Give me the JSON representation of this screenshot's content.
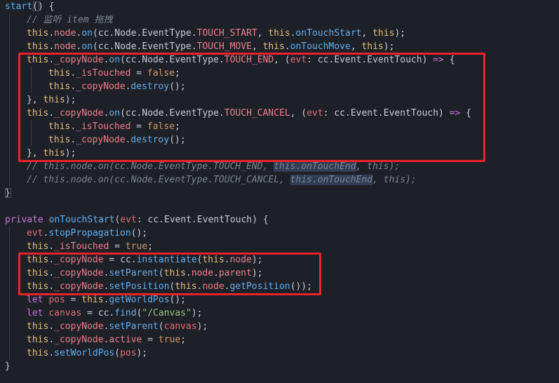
{
  "lines": [
    {
      "indent": 0,
      "tokens": [
        {
          "c": "t-method",
          "v": "start"
        },
        {
          "c": "t-punc",
          "v": "() "
        },
        {
          "c": "t-punc",
          "v": "{"
        }
      ]
    },
    {
      "indent": 1,
      "tokens": [
        {
          "c": "t-comment",
          "v": "// 监听 item 拖拽"
        }
      ]
    },
    {
      "indent": 1,
      "tokens": [
        {
          "c": "t-this",
          "v": "this"
        },
        {
          "c": "t-punc",
          "v": "."
        },
        {
          "c": "t-prop",
          "v": "node"
        },
        {
          "c": "t-punc",
          "v": "."
        },
        {
          "c": "t-method",
          "v": "on"
        },
        {
          "c": "t-punc",
          "v": "(cc.Node.EventType."
        },
        {
          "c": "t-const",
          "v": "TOUCH_START"
        },
        {
          "c": "t-punc",
          "v": ", "
        },
        {
          "c": "t-this",
          "v": "this"
        },
        {
          "c": "t-punc",
          "v": "."
        },
        {
          "c": "t-method",
          "v": "onTouchStart"
        },
        {
          "c": "t-punc",
          "v": ", "
        },
        {
          "c": "t-this",
          "v": "this"
        },
        {
          "c": "t-punc",
          "v": ");"
        }
      ]
    },
    {
      "indent": 1,
      "tokens": [
        {
          "c": "t-this",
          "v": "this"
        },
        {
          "c": "t-punc",
          "v": "."
        },
        {
          "c": "t-prop",
          "v": "node"
        },
        {
          "c": "t-punc",
          "v": "."
        },
        {
          "c": "t-method",
          "v": "on"
        },
        {
          "c": "t-punc",
          "v": "(cc.Node.EventType."
        },
        {
          "c": "t-const",
          "v": "TOUCH_MOVE"
        },
        {
          "c": "t-punc",
          "v": ", "
        },
        {
          "c": "t-this",
          "v": "this"
        },
        {
          "c": "t-punc",
          "v": "."
        },
        {
          "c": "t-method",
          "v": "onTouchMove"
        },
        {
          "c": "t-punc",
          "v": ", "
        },
        {
          "c": "t-this",
          "v": "this"
        },
        {
          "c": "t-punc",
          "v": ");"
        }
      ]
    },
    {
      "indent": 1,
      "tokens": [
        {
          "c": "t-this",
          "v": "this"
        },
        {
          "c": "t-punc",
          "v": "."
        },
        {
          "c": "t-prop",
          "v": "_copyNode"
        },
        {
          "c": "t-punc",
          "v": "."
        },
        {
          "c": "t-method",
          "v": "on"
        },
        {
          "c": "t-punc",
          "v": "(cc.Node.EventType."
        },
        {
          "c": "t-const",
          "v": "TOUCH_END"
        },
        {
          "c": "t-punc",
          "v": ", ("
        },
        {
          "c": "t-param",
          "v": "evt"
        },
        {
          "c": "t-punc",
          "v": ": cc.Event.EventTouch) "
        },
        {
          "c": "t-kw",
          "v": "=>"
        },
        {
          "c": "t-punc",
          "v": " {"
        }
      ]
    },
    {
      "indent": 2,
      "tokens": [
        {
          "c": "t-this",
          "v": "this"
        },
        {
          "c": "t-punc",
          "v": "."
        },
        {
          "c": "t-prop",
          "v": "_isTouched"
        },
        {
          "c": "t-punc",
          "v": " = "
        },
        {
          "c": "t-bool",
          "v": "false"
        },
        {
          "c": "t-punc",
          "v": ";"
        }
      ]
    },
    {
      "indent": 2,
      "tokens": [
        {
          "c": "t-this",
          "v": "this"
        },
        {
          "c": "t-punc",
          "v": "."
        },
        {
          "c": "t-prop",
          "v": "_copyNode"
        },
        {
          "c": "t-punc",
          "v": "."
        },
        {
          "c": "t-method",
          "v": "destroy"
        },
        {
          "c": "t-punc",
          "v": "();"
        }
      ]
    },
    {
      "indent": 1,
      "tokens": [
        {
          "c": "t-punc",
          "v": "}, "
        },
        {
          "c": "t-this",
          "v": "this"
        },
        {
          "c": "t-punc",
          "v": ");"
        }
      ]
    },
    {
      "indent": 1,
      "tokens": [
        {
          "c": "t-this",
          "v": "this"
        },
        {
          "c": "t-punc",
          "v": "."
        },
        {
          "c": "t-prop",
          "v": "_copyNode"
        },
        {
          "c": "t-punc",
          "v": "."
        },
        {
          "c": "t-method",
          "v": "on"
        },
        {
          "c": "t-punc",
          "v": "(cc.Node.EventType."
        },
        {
          "c": "t-const",
          "v": "TOUCH_CANCEL"
        },
        {
          "c": "t-punc",
          "v": ", ("
        },
        {
          "c": "t-param",
          "v": "evt"
        },
        {
          "c": "t-punc",
          "v": ": cc.Event.EventTouch) "
        },
        {
          "c": "t-kw",
          "v": "=>"
        },
        {
          "c": "t-punc",
          "v": " {"
        }
      ]
    },
    {
      "indent": 2,
      "tokens": [
        {
          "c": "t-this",
          "v": "this"
        },
        {
          "c": "t-punc",
          "v": "."
        },
        {
          "c": "t-prop",
          "v": "_isTouched"
        },
        {
          "c": "t-punc",
          "v": " = "
        },
        {
          "c": "t-bool",
          "v": "false"
        },
        {
          "c": "t-punc",
          "v": ";"
        }
      ]
    },
    {
      "indent": 2,
      "tokens": [
        {
          "c": "t-this",
          "v": "this"
        },
        {
          "c": "t-punc",
          "v": "."
        },
        {
          "c": "t-prop",
          "v": "_copyNode"
        },
        {
          "c": "t-punc",
          "v": "."
        },
        {
          "c": "t-method",
          "v": "destroy"
        },
        {
          "c": "t-punc",
          "v": "();"
        }
      ]
    },
    {
      "indent": 1,
      "tokens": [
        {
          "c": "t-punc",
          "v": "}, "
        },
        {
          "c": "t-this",
          "v": "this"
        },
        {
          "c": "t-punc",
          "v": ");"
        }
      ]
    },
    {
      "indent": 1,
      "tokens": [
        {
          "c": "t-comment",
          "v": "// this.node.on(cc.Node.EventType.TOUCH_END, "
        },
        {
          "c": "t-comment t-hl",
          "v": "this.onTouchEnd"
        },
        {
          "c": "t-comment",
          "v": ", this);"
        }
      ]
    },
    {
      "indent": 1,
      "tokens": [
        {
          "c": "t-comment",
          "v": "// this.node.on(cc.Node.EventType.TOUCH_CANCEL, "
        },
        {
          "c": "t-comment t-hl",
          "v": "this.onTouchEnd"
        },
        {
          "c": "t-comment",
          "v": ", this);"
        }
      ]
    },
    {
      "indent": 0,
      "tokens": [
        {
          "c": "t-punc",
          "v": "}"
        }
      ]
    },
    {
      "indent": 0,
      "tokens": []
    },
    {
      "indent": 0,
      "tokens": [
        {
          "c": "t-kw",
          "v": "private"
        },
        {
          "c": "t-punc",
          "v": " "
        },
        {
          "c": "t-method",
          "v": "onTouchStart"
        },
        {
          "c": "t-punc",
          "v": "("
        },
        {
          "c": "t-param",
          "v": "evt"
        },
        {
          "c": "t-punc",
          "v": ": cc.Event.EventTouch) {"
        }
      ]
    },
    {
      "indent": 1,
      "tokens": [
        {
          "c": "t-param",
          "v": "evt"
        },
        {
          "c": "t-punc",
          "v": "."
        },
        {
          "c": "t-method",
          "v": "stopPropagation"
        },
        {
          "c": "t-punc",
          "v": "();"
        }
      ]
    },
    {
      "indent": 1,
      "tokens": [
        {
          "c": "t-this",
          "v": "this"
        },
        {
          "c": "t-punc",
          "v": "."
        },
        {
          "c": "t-prop",
          "v": "_isTouched"
        },
        {
          "c": "t-punc",
          "v": " = "
        },
        {
          "c": "t-bool",
          "v": "true"
        },
        {
          "c": "t-punc",
          "v": ";"
        }
      ]
    },
    {
      "indent": 1,
      "tokens": [
        {
          "c": "t-this",
          "v": "this"
        },
        {
          "c": "t-punc",
          "v": "."
        },
        {
          "c": "t-prop",
          "v": "_copyNode"
        },
        {
          "c": "t-punc",
          "v": " = cc."
        },
        {
          "c": "t-method",
          "v": "instantiate"
        },
        {
          "c": "t-punc",
          "v": "("
        },
        {
          "c": "t-this",
          "v": "this"
        },
        {
          "c": "t-punc",
          "v": "."
        },
        {
          "c": "t-prop",
          "v": "node"
        },
        {
          "c": "t-punc",
          "v": ");"
        }
      ]
    },
    {
      "indent": 1,
      "tokens": [
        {
          "c": "t-this",
          "v": "this"
        },
        {
          "c": "t-punc",
          "v": "."
        },
        {
          "c": "t-prop",
          "v": "_copyNode"
        },
        {
          "c": "t-punc",
          "v": "."
        },
        {
          "c": "t-method",
          "v": "setParent"
        },
        {
          "c": "t-punc",
          "v": "("
        },
        {
          "c": "t-this",
          "v": "this"
        },
        {
          "c": "t-punc",
          "v": "."
        },
        {
          "c": "t-prop",
          "v": "node"
        },
        {
          "c": "t-punc",
          "v": "."
        },
        {
          "c": "t-prop",
          "v": "parent"
        },
        {
          "c": "t-punc",
          "v": ");"
        }
      ]
    },
    {
      "indent": 1,
      "tokens": [
        {
          "c": "t-this",
          "v": "this"
        },
        {
          "c": "t-punc",
          "v": "."
        },
        {
          "c": "t-prop",
          "v": "_copyNode"
        },
        {
          "c": "t-punc",
          "v": "."
        },
        {
          "c": "t-method",
          "v": "setPosition"
        },
        {
          "c": "t-punc",
          "v": "("
        },
        {
          "c": "t-this",
          "v": "this"
        },
        {
          "c": "t-punc",
          "v": "."
        },
        {
          "c": "t-prop",
          "v": "node"
        },
        {
          "c": "t-punc",
          "v": "."
        },
        {
          "c": "t-method",
          "v": "getPosition"
        },
        {
          "c": "t-punc",
          "v": "());"
        }
      ]
    },
    {
      "indent": 1,
      "tokens": [
        {
          "c": "t-kw",
          "v": "let"
        },
        {
          "c": "t-punc",
          "v": " "
        },
        {
          "c": "t-param",
          "v": "pos"
        },
        {
          "c": "t-punc",
          "v": " = "
        },
        {
          "c": "t-this",
          "v": "this"
        },
        {
          "c": "t-punc",
          "v": "."
        },
        {
          "c": "t-method",
          "v": "getWorldPos"
        },
        {
          "c": "t-punc",
          "v": "();"
        }
      ]
    },
    {
      "indent": 1,
      "tokens": [
        {
          "c": "t-kw",
          "v": "let"
        },
        {
          "c": "t-punc",
          "v": " "
        },
        {
          "c": "t-param",
          "v": "canvas"
        },
        {
          "c": "t-punc",
          "v": " = cc."
        },
        {
          "c": "t-method",
          "v": "find"
        },
        {
          "c": "t-punc",
          "v": "("
        },
        {
          "c": "t-str",
          "v": "\"/Canvas\""
        },
        {
          "c": "t-punc",
          "v": ");"
        }
      ]
    },
    {
      "indent": 1,
      "tokens": [
        {
          "c": "t-this",
          "v": "this"
        },
        {
          "c": "t-punc",
          "v": "."
        },
        {
          "c": "t-prop",
          "v": "_copyNode"
        },
        {
          "c": "t-punc",
          "v": "."
        },
        {
          "c": "t-method",
          "v": "setParent"
        },
        {
          "c": "t-punc",
          "v": "("
        },
        {
          "c": "t-param",
          "v": "canvas"
        },
        {
          "c": "t-punc",
          "v": ");"
        }
      ]
    },
    {
      "indent": 1,
      "tokens": [
        {
          "c": "t-this",
          "v": "this"
        },
        {
          "c": "t-punc",
          "v": "."
        },
        {
          "c": "t-prop",
          "v": "_copyNode"
        },
        {
          "c": "t-punc",
          "v": "."
        },
        {
          "c": "t-prop",
          "v": "active"
        },
        {
          "c": "t-punc",
          "v": " = "
        },
        {
          "c": "t-bool",
          "v": "true"
        },
        {
          "c": "t-punc",
          "v": ";"
        }
      ]
    },
    {
      "indent": 1,
      "tokens": [
        {
          "c": "t-this",
          "v": "this"
        },
        {
          "c": "t-punc",
          "v": "."
        },
        {
          "c": "t-method",
          "v": "setWorldPos"
        },
        {
          "c": "t-punc",
          "v": "("
        },
        {
          "c": "t-param",
          "v": "pos"
        },
        {
          "c": "t-punc",
          "v": ");"
        }
      ]
    },
    {
      "indent": 0,
      "tokens": [
        {
          "c": "t-punc",
          "v": "}"
        }
      ]
    }
  ],
  "highlights": [
    {
      "name": "touch-end-cancel-block",
      "from": 4,
      "to": 11
    },
    {
      "name": "copy-node-setup-block",
      "from": 19,
      "to": 21
    }
  ]
}
